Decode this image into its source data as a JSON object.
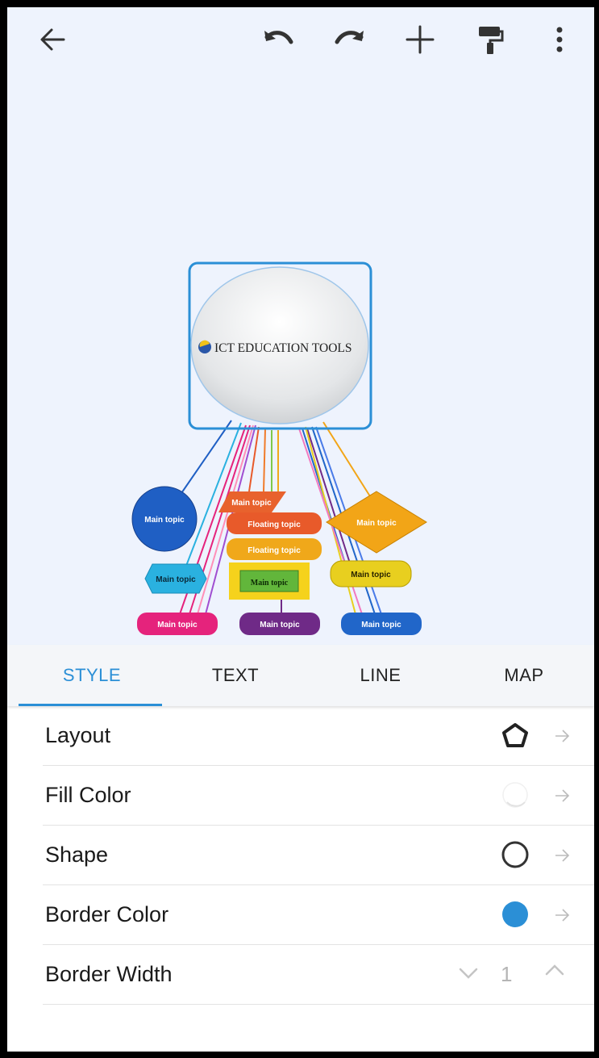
{
  "toolbar": {
    "icons": [
      "back-arrow-icon",
      "undo-icon",
      "redo-icon",
      "add-icon",
      "format-painter-icon",
      "more-vert-icon"
    ]
  },
  "mindmap": {
    "central_topic": "ICT EDUCATION TOOLS",
    "nodes": {
      "circle_left": "Main topic",
      "parallelogram_top": "Main topic",
      "floating_1": "Floating topic",
      "floating_2": "Floating topic",
      "green_box": "Main topic",
      "diamond_right": "Main topic",
      "hexagon_left": "Main topic",
      "yellow_right": "Main topic",
      "pink_bottom": "Main topic",
      "purple_bottom": "Main topic",
      "blue_bottom": "Main topic"
    },
    "colors": {
      "selection_border": "#2b8fd6",
      "circle_left": "#1f5fc4",
      "parallelogram_top": "#e8622d",
      "floating_1": "#e85a2a",
      "floating_2": "#f0a81a",
      "green_box": "#62b63b",
      "diamond_right": "#f2a517",
      "hexagon_left": "#2ab1e0",
      "yellow_right": "#e8cf1f",
      "pink_bottom": "#e5237c",
      "purple_bottom": "#6f2a87",
      "blue_bottom": "#2166c9"
    }
  },
  "tabs": [
    {
      "label": "STYLE",
      "active": true
    },
    {
      "label": "TEXT",
      "active": false
    },
    {
      "label": "LINE",
      "active": false
    },
    {
      "label": "MAP",
      "active": false
    }
  ],
  "settings": {
    "layout": {
      "label": "Layout",
      "icon": "pentagon-layout-icon"
    },
    "fill_color": {
      "label": "Fill Color",
      "color": "#ffffff"
    },
    "shape": {
      "label": "Shape",
      "icon": "circle-outline-icon"
    },
    "border_color": {
      "label": "Border Color",
      "color": "#2b8fd6"
    },
    "border_width": {
      "label": "Border Width",
      "value": "1"
    }
  }
}
